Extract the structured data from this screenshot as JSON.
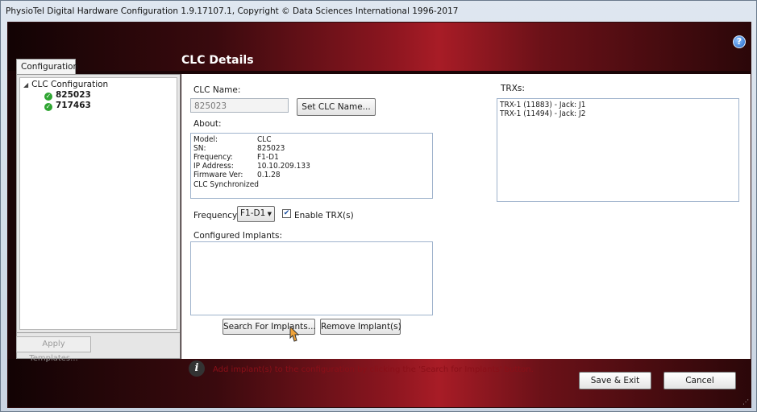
{
  "window": {
    "title": "PhysioTel Digital Hardware Configuration 1.9.17107.1, Copyright © Data Sciences International 1996-2017"
  },
  "header": {
    "help_icon": "?"
  },
  "sidebar": {
    "tab_label": "Configuration",
    "tree_root": "CLC Configuration",
    "items": [
      {
        "label": "825023",
        "status": "ok"
      },
      {
        "label": "717463",
        "status": "ok"
      }
    ],
    "apply_button": "Apply Templates..."
  },
  "main": {
    "title": "CLC Details",
    "clc_name_label": "CLC Name:",
    "clc_name_value": "825023",
    "set_name_button": "Set CLC Name...",
    "about_label": "About:",
    "about": [
      {
        "key": "Model:",
        "value": "CLC"
      },
      {
        "key": "SN:",
        "value": "825023"
      },
      {
        "key": "Frequency:",
        "value": "F1-D1"
      },
      {
        "key": "IP Address:",
        "value": "10.10.209.133"
      },
      {
        "key": "Firmware Ver:",
        "value": "0.1.28"
      },
      {
        "key": "CLC Synchronized",
        "value": ""
      }
    ],
    "frequency_label": "Frequency:",
    "frequency_value": "F1-D1",
    "enable_trx_label": "Enable TRX(s)",
    "enable_trx_checked": true,
    "configured_implants_label": "Configured Implants:",
    "search_button": "Search For Implants...",
    "remove_button": "Remove Implant(s)",
    "trxs_label": "TRXs:",
    "trxs": [
      "TRX-1 (11883) - Jack: J1",
      "TRX-1 (11494) - Jack: J2"
    ],
    "hint": "Add implant(s) to the configuration by clicking the 'Search for Implants' button."
  },
  "footer": {
    "save_button": "Save & Exit",
    "cancel_button": "Cancel"
  },
  "colors": {
    "accent_dark": "#1b0507",
    "accent_red": "#a81c26",
    "hint_red": "#8b0f18",
    "ok_green": "#2fa532"
  }
}
